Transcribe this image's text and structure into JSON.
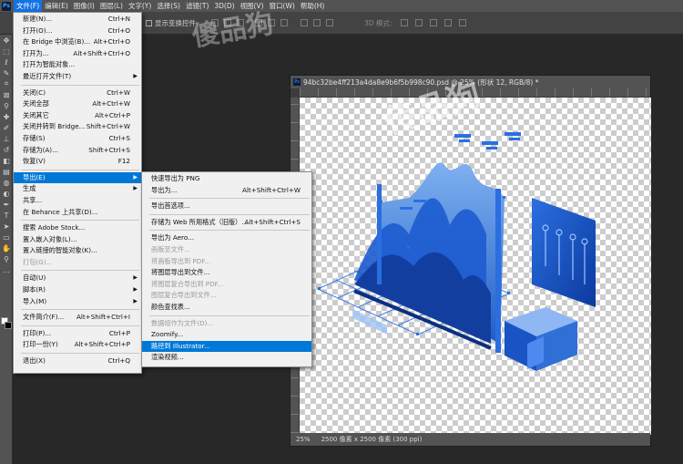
{
  "menubar": {
    "logo": "Ps",
    "items": [
      "文件(F)",
      "编辑(E)",
      "图像(I)",
      "图层(L)",
      "文字(Y)",
      "选择(S)",
      "滤镜(T)",
      "3D(D)",
      "视图(V)",
      "窗口(W)",
      "帮助(H)"
    ]
  },
  "options": {
    "show_transform": "显示变换控件",
    "mode_3d": "3D 模式:"
  },
  "file_menu": [
    {
      "label": "新建(N)...",
      "shortcut": "Ctrl+N"
    },
    {
      "label": "打开(O)...",
      "shortcut": "Ctrl+O"
    },
    {
      "label": "在 Bridge 中浏览(B)...",
      "shortcut": "Alt+Ctrl+O"
    },
    {
      "label": "打开为...",
      "shortcut": "Alt+Shift+Ctrl+O"
    },
    {
      "label": "打开为智能对象...",
      "shortcut": ""
    },
    {
      "label": "最近打开文件(T)",
      "shortcut": "",
      "submenu": true
    },
    {
      "sep": true
    },
    {
      "label": "关闭(C)",
      "shortcut": "Ctrl+W"
    },
    {
      "label": "关闭全部",
      "shortcut": "Alt+Ctrl+W"
    },
    {
      "label": "关闭其它",
      "shortcut": "Alt+Ctrl+P"
    },
    {
      "label": "关闭并转到 Bridge...",
      "shortcut": "Shift+Ctrl+W"
    },
    {
      "label": "存储(S)",
      "shortcut": "Ctrl+S"
    },
    {
      "label": "存储为(A)...",
      "shortcut": "Shift+Ctrl+S"
    },
    {
      "label": "恢复(V)",
      "shortcut": "F12"
    },
    {
      "sep": true
    },
    {
      "label": "导出(E)",
      "shortcut": "",
      "submenu": true,
      "selected": true
    },
    {
      "label": "生成",
      "shortcut": "",
      "submenu": true
    },
    {
      "label": "共享...",
      "shortcut": ""
    },
    {
      "label": "在 Behance 上共享(D)...",
      "shortcut": ""
    },
    {
      "sep": true
    },
    {
      "label": "搜索 Adobe Stock...",
      "shortcut": ""
    },
    {
      "label": "置入嵌入对象(L)...",
      "shortcut": ""
    },
    {
      "label": "置入链接的智能对象(K)...",
      "shortcut": ""
    },
    {
      "label": "打包(G)...",
      "shortcut": "",
      "disabled": true
    },
    {
      "sep": true
    },
    {
      "label": "自动(U)",
      "shortcut": "",
      "submenu": true
    },
    {
      "label": "脚本(R)",
      "shortcut": "",
      "submenu": true
    },
    {
      "label": "导入(M)",
      "shortcut": "",
      "submenu": true
    },
    {
      "sep": true
    },
    {
      "label": "文件简介(F)...",
      "shortcut": "Alt+Shift+Ctrl+I"
    },
    {
      "sep": true
    },
    {
      "label": "打印(P)...",
      "shortcut": "Ctrl+P"
    },
    {
      "label": "打印一份(Y)",
      "shortcut": "Alt+Shift+Ctrl+P"
    },
    {
      "sep": true
    },
    {
      "label": "退出(X)",
      "shortcut": "Ctrl+Q"
    }
  ],
  "export_menu": [
    {
      "label": "快速导出为 PNG",
      "shortcut": ""
    },
    {
      "label": "导出为...",
      "shortcut": "Alt+Shift+Ctrl+W"
    },
    {
      "sep": true
    },
    {
      "label": "导出首选项...",
      "shortcut": ""
    },
    {
      "sep": true
    },
    {
      "label": "存储为 Web 所用格式（旧版）...",
      "shortcut": "Alt+Shift+Ctrl+S"
    },
    {
      "sep": true
    },
    {
      "label": "导出为 Aero...",
      "shortcut": ""
    },
    {
      "label": "画板至文件...",
      "shortcut": "",
      "disabled": true
    },
    {
      "label": "将画板导出到 PDF...",
      "shortcut": "",
      "disabled": true
    },
    {
      "label": "将图层导出到文件...",
      "shortcut": ""
    },
    {
      "label": "将图层复合导出到 PDF...",
      "shortcut": "",
      "disabled": true
    },
    {
      "label": "图层复合导出到文件...",
      "shortcut": "",
      "disabled": true
    },
    {
      "label": "颜色查找表...",
      "shortcut": ""
    },
    {
      "sep": true
    },
    {
      "label": "数据组作为文件(D)...",
      "shortcut": "",
      "disabled": true
    },
    {
      "label": "Zoomify...",
      "shortcut": ""
    },
    {
      "label": "路径到 Illustrator...",
      "shortcut": "",
      "selected": true
    },
    {
      "label": "渲染视频...",
      "shortcut": ""
    }
  ],
  "document": {
    "tab_title": "94bc32be4ff213a4da8e9b6f5b998c90.psd @ 25% (形状 12, RGB/8) *",
    "zoom": "25%",
    "doc_size": "2500 像素 x 2500 像素 (300 ppi)"
  },
  "watermark": {
    "brand": "传品狗",
    "brand2": "传品狗",
    "brand3": "傻品狗"
  },
  "colors": {
    "accent": "#1473e6",
    "menu_highlight": "#0078d7",
    "chart_blue": "#2f6fd6"
  }
}
